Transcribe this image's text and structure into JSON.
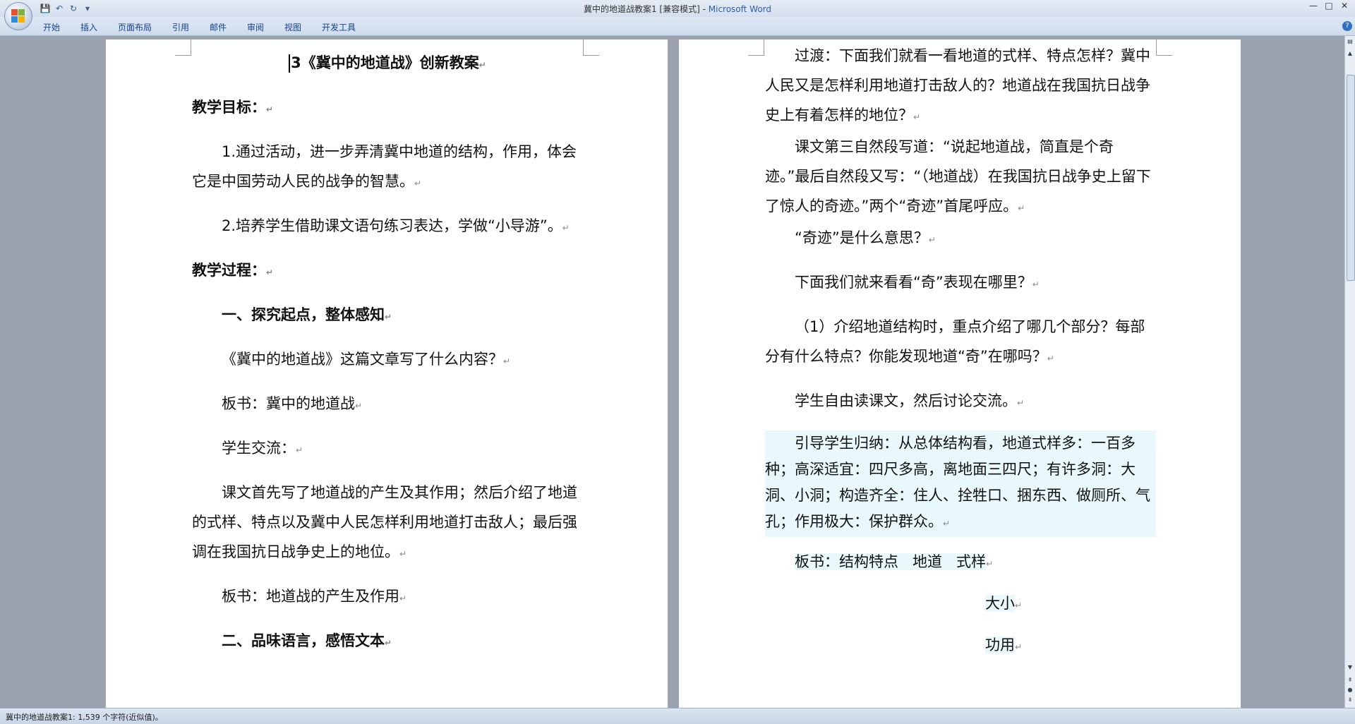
{
  "window": {
    "title": "冀中的地道战教案1 [兼容模式] - ",
    "app_name": "Microsoft Word",
    "controls": [
      "—",
      "□",
      "✕"
    ]
  },
  "quick_access": [
    "save-icon",
    "undo-icon",
    "redo-icon",
    "customize-icon"
  ],
  "ribbon": {
    "tabs": [
      "开始",
      "插入",
      "页面布局",
      "引用",
      "邮件",
      "审阅",
      "视图",
      "开发工具"
    ]
  },
  "left_page": {
    "title": "3《冀中的地道战》创新教案",
    "goals_heading": "教学目标：",
    "goal1": "1.通过活动，进一步弄清冀中地道的结构，作用，体会它是中国劳动人民的战争的智慧。",
    "goal2": "2.培养学生借助课文语句练习表达，学做“小导游”。",
    "process_heading": "教学过程：",
    "section1": "一、探究起点，整体感知",
    "q1": "《冀中的地道战》这篇文章写了什么内容？",
    "board1": "板书：冀中的地道战",
    "exchange": "学生交流：",
    "summary": "课文首先写了地道战的产生及其作用；然后介绍了地道的式样、特点以及冀中人民怎样利用地道打击敌人；最后强调在我国抗日战争史上的地位。",
    "board2": "板书：地道战的产生及作用",
    "section2": "二、品味语言，感悟文本"
  },
  "right_page": {
    "transition": "过渡：下面我们就看一看地道的式样、特点怎样？冀中人民又是怎样利用地道打击敌人的？地道战在我国抗日战争史上有着怎样的地位？",
    "para3": "课文第三自然段写道：“说起地道战，简直是个奇迹。”最后自然段又写：“（地道战）在我国抗日战争史上留下了惊人的奇迹。”两个“奇迹”首尾呼应。",
    "miracle_q": "“奇迹”是什么意思？",
    "where_q": "下面我们就来看看“奇”表现在哪里？",
    "q_structure": "（1）介绍地道结构时，重点介绍了哪几个部分？每部分有什么特点？你能发现地道“奇”在哪吗？",
    "discuss": "学生自由读课文，然后讨论交流。",
    "guide": "引导学生归纳：从总体结构看，地道式样多：一百多种；高深适宜：四尺多高，离地面三四尺；有许多洞：大洞、小洞；构造齐全：住人、拴牲口、捆东西、做厕所、气孔；作用极大：保护群众。",
    "board3": "板书：结构特点   地道   式样",
    "board3b": "大小",
    "board3c": "功用"
  },
  "status": {
    "text": "冀中的地道战教案1: 1,539 个字符(近似值)。"
  },
  "paragraph_mark": "↵"
}
